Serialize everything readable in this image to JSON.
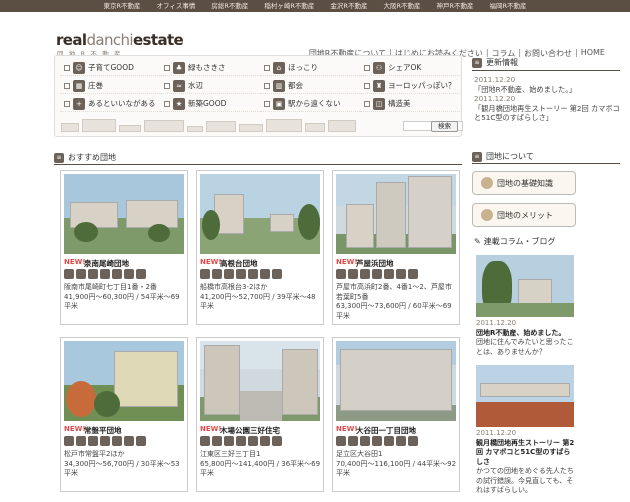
{
  "topbar": {
    "links": [
      "東京R不動産",
      "オフィス事情",
      "房総R不動産",
      "稲村ヶ崎R不動産",
      "金沢R不動産",
      "大阪R不動産",
      "神戸R不動産",
      "福岡R不動産"
    ]
  },
  "header": {
    "logo_main": "real",
    "logo_mid": "danchi",
    "logo_end": "estate",
    "logo_sub": "団地R不動産",
    "nav": [
      "団地R不動産について",
      "はじめにお読みください",
      "コラム",
      "お問い合わせ",
      "HOME"
    ],
    "nav_sep": "|"
  },
  "search": {
    "items": [
      {
        "label": "子育てGOOD",
        "icon": "child-icon"
      },
      {
        "label": "緑もさきさ",
        "icon": "tree-icon"
      },
      {
        "label": "ほっこり",
        "icon": "house-icon"
      },
      {
        "label": "シェアOK",
        "icon": "share-icon"
      },
      {
        "label": "庄巻",
        "icon": "building-icon"
      },
      {
        "label": "水辺",
        "icon": "water-icon"
      },
      {
        "label": "都会",
        "icon": "city-icon"
      },
      {
        "label": "ヨーロッパっぽい？",
        "icon": "europe-icon"
      },
      {
        "label": "あるといいながある",
        "icon": "plus-icon"
      },
      {
        "label": "新築GOOD",
        "icon": "new-icon"
      },
      {
        "label": "駅から遠くない",
        "icon": "train-icon"
      },
      {
        "label": "構造美",
        "icon": "structure-icon"
      }
    ],
    "button": "検索"
  },
  "updates": {
    "heading": "更新情報",
    "items": [
      {
        "date": "2011.12.20",
        "text": "「団地R不動産、始めました。」"
      },
      {
        "date": "2011.12.20",
        "text": "「観月橋団地再生ストーリー 第2回 カマボコと51C型のすばらしさ」"
      }
    ]
  },
  "recommended": {
    "heading": "おすすめ団地",
    "new_badge": "NEW!",
    "cards": [
      {
        "title": "泉南尾崎団地",
        "address": "阪南市尾崎町七丁目1番・2番",
        "price": "41,900円〜60,300円 / 54平米〜69平米"
      },
      {
        "title": "高根台団地",
        "address": "船橋市高根台3-2ほか",
        "price": "41,200円〜52,700円 / 39平米〜48平米"
      },
      {
        "title": "芦屋浜団地",
        "address": "芦屋市高浜町2番、4番1〜2、芦屋市若葉町5番",
        "price": "63,300円〜73,600円 / 60平米〜69平米"
      },
      {
        "title": "常盤平団地",
        "address": "松戸市常盤平2ほか",
        "price": "34,300円〜56,700円 / 30平米〜53平米"
      },
      {
        "title": "木場公園三好住宅",
        "address": "江東区三好三丁目1",
        "price": "65,800円〜141,400円 / 36平米〜69平米"
      },
      {
        "title": "大谷田一丁目団地",
        "address": "足立区大谷田1",
        "price": "70,400円〜116,100円 / 44平米〜92平米"
      }
    ]
  },
  "sidebar": {
    "about_heading": "団地について",
    "buttons": [
      "団地の基礎知識",
      "団地のメリット"
    ],
    "column_heading": "連載コラム・ブログ",
    "columns": [
      {
        "date": "2011.12.20",
        "title": "団地R不動産、始めました。",
        "text": "団地に住んでみたいと思ったことは、ありませんか？"
      },
      {
        "date": "2011.12.20",
        "title": "観月橋団地再生ストーリー 第2回 カマボコと51C型のすばらしさ",
        "text": "かつての団地をめぐる先人たちの試行錯誤。今見直しても、それはすばらしい。"
      }
    ]
  }
}
